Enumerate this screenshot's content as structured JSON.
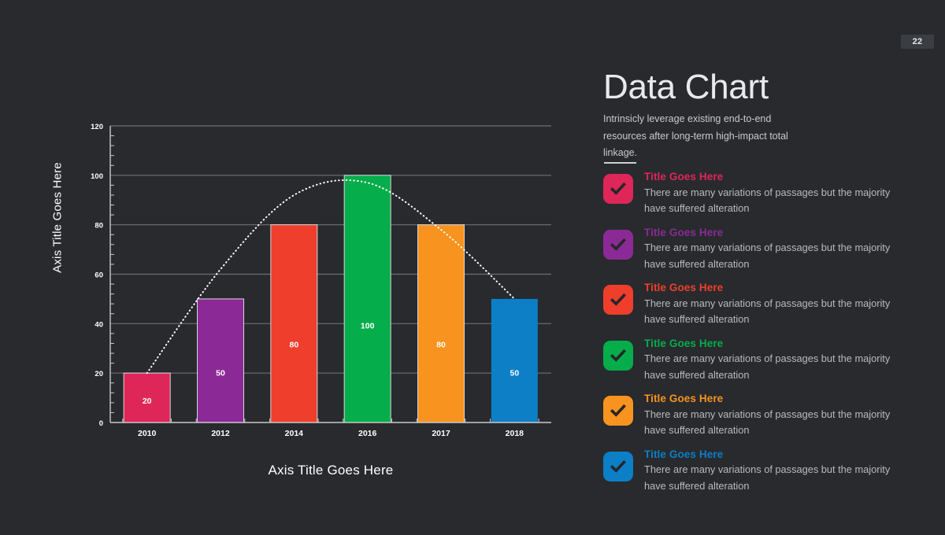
{
  "page_number": "22",
  "header": {
    "title": "Data Chart",
    "subtitle": "Intrinsicly leverage existing end-to-end resources after long-term high-impact total linkage."
  },
  "colors": {
    "background": "#282a2e",
    "grid": "#6d6f74",
    "axis": "#c9cacc",
    "text": "#ffffff",
    "muted_text": "#b9babd",
    "badge_bg": "#3a3d42",
    "pink": "#de2659",
    "purple": "#8b2a96",
    "red": "#ef3e2b",
    "green": "#05ad4b",
    "orange": "#f7931e",
    "blue": "#0c7fc7"
  },
  "features": [
    {
      "title": "Title Goes Here",
      "description": "There are many variations of passages but the majority have  suffered alteration",
      "color": "#de2659",
      "icon": "check-icon"
    },
    {
      "title": "Title Goes Here",
      "description": "There are many variations of passages but the majority have  suffered alteration",
      "color": "#8b2a96",
      "icon": "check-icon"
    },
    {
      "title": "Title Goes Here",
      "description": "There are many variations of passages but the majority have  suffered alteration",
      "color": "#ef3e2b",
      "icon": "check-icon"
    },
    {
      "title": "Title Goes Here",
      "description": "There are many variations of passages but the majority have  suffered alteration",
      "color": "#05ad4b",
      "icon": "check-icon"
    },
    {
      "title": "Title Goes Here",
      "description": "There are many variations of passages but the majority have  suffered alteration",
      "color": "#f7931e",
      "icon": "check-icon"
    },
    {
      "title": "Title Goes Here",
      "description": "There are many variations of passages but the majority have  suffered alteration",
      "color": "#0c7fc7",
      "icon": "check-icon"
    }
  ],
  "chart_data": {
    "type": "bar",
    "title": "",
    "categories": [
      "2010",
      "2012",
      "2014",
      "2016",
      "2017",
      "2018"
    ],
    "values": [
      20,
      50,
      80,
      100,
      80,
      50
    ],
    "bar_colors": [
      "#de2659",
      "#8b2a96",
      "#ef3e2b",
      "#05ad4b",
      "#f7931e",
      "#0c7fc7"
    ],
    "data_labels": [
      "20",
      "50",
      "80",
      "100",
      "80",
      "50"
    ],
    "xlabel": "Axis Title Goes Here",
    "ylabel": "Axis Title Goes Here",
    "ylim": [
      0,
      120
    ],
    "yticks": [
      0,
      20,
      40,
      60,
      80,
      100,
      120
    ],
    "ytick_labels": [
      "0",
      "20",
      "40",
      "60",
      "80",
      "100",
      "120"
    ],
    "minor_ticks_per_interval": 4,
    "grid": true,
    "legend": false,
    "trendline": {
      "type": "polynomial",
      "style": "dotted",
      "color": "#ffffff",
      "values": [
        20,
        62,
        92,
        97,
        78,
        50
      ]
    }
  }
}
